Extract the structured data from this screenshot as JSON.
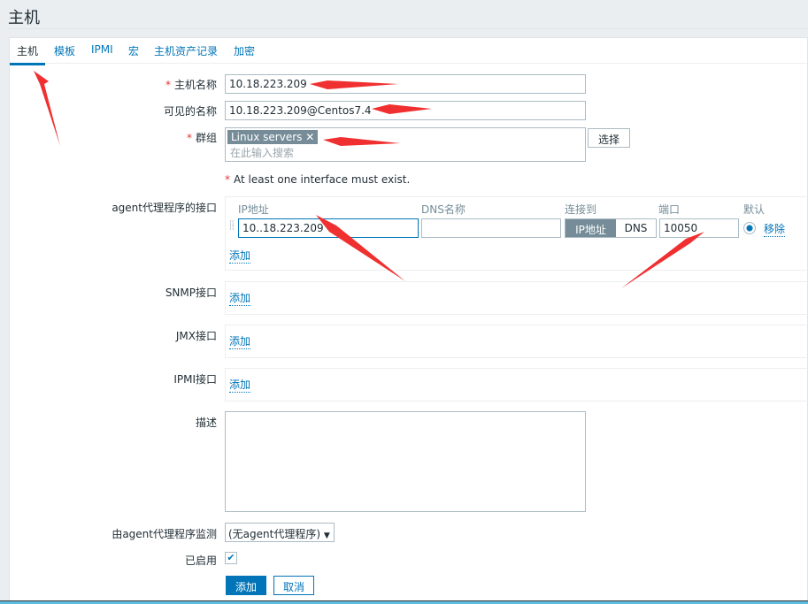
{
  "page_title": "主机",
  "tabs": [
    "主机",
    "模板",
    "IPMI",
    "宏",
    "主机资产记录",
    "加密"
  ],
  "form": {
    "host_name": {
      "label": "主机名称",
      "value": "10.18.223.209"
    },
    "visible_name": {
      "label": "可见的名称",
      "value": "10.18.223.209@Centos7.4"
    },
    "groups": {
      "label": "群组",
      "tag": "Linux servers",
      "placeholder": "在此输入搜索",
      "select_button": "选择"
    },
    "warning": "At least one interface must exist.",
    "required_mark": "*",
    "agent": {
      "label": "agent代理程序的接口",
      "headers": [
        "IP地址",
        "DNS名称",
        "连接到",
        "端口",
        "默认"
      ],
      "ip": "10..18.223.209",
      "dns": "",
      "connect_ip": "IP地址",
      "connect_dns": "DNS",
      "port": "10050",
      "remove": "移除",
      "add": "添加"
    },
    "snmp": {
      "label": "SNMP接口",
      "add": "添加"
    },
    "jmx": {
      "label": "JMX接口",
      "add": "添加"
    },
    "ipmi": {
      "label": "IPMI接口",
      "add": "添加"
    },
    "description": {
      "label": "描述",
      "value": ""
    },
    "proxy": {
      "label": "由agent代理程序监测",
      "value": "(无agent代理程序)"
    },
    "enabled": {
      "label": "已启用",
      "checked": true
    },
    "add_button": "添加",
    "cancel_button": "取消"
  },
  "colors": {
    "accent": "#0275b8",
    "required": "#e33734",
    "arrow": "#f03030"
  }
}
